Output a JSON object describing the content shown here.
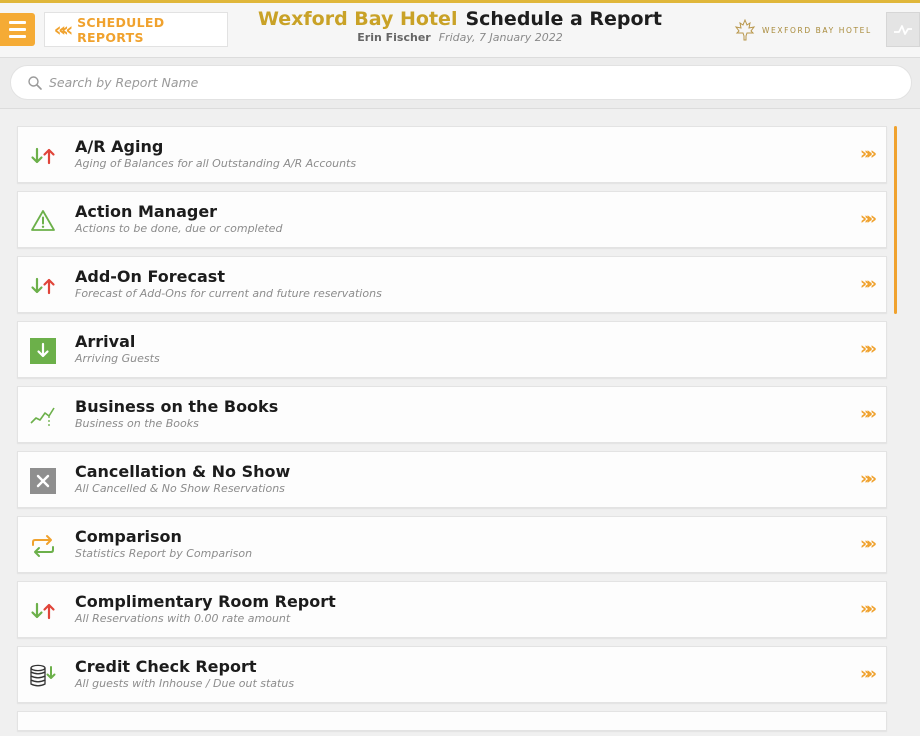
{
  "header": {
    "back_label": "SCHEDULED REPORTS",
    "hotel_name": "Wexford Bay Hotel",
    "page_title": "Schedule a Report",
    "user_name": "Erin Fischer",
    "date": "Friday, 7 January 2022",
    "logo_text": "WEXFORD BAY HOTEL"
  },
  "search": {
    "placeholder": "Search by Report Name",
    "value": ""
  },
  "colors": {
    "accent": "#f0a22e",
    "brand_gold": "#c9a227",
    "green": "#6cb04a",
    "red": "#e0453a",
    "gray": "#8f8f8f"
  },
  "reports": [
    {
      "title": "A/R Aging",
      "subtitle": "Aging of Balances for all Outstanding A/R Accounts",
      "icon": "arrows-up-down-icon"
    },
    {
      "title": "Action Manager",
      "subtitle": "Actions to be done, due or completed",
      "icon": "warning-icon"
    },
    {
      "title": "Add-On Forecast",
      "subtitle": "Forecast of Add-Ons for current and future reservations",
      "icon": "arrows-up-down-icon"
    },
    {
      "title": "Arrival",
      "subtitle": "Arriving Guests",
      "icon": "arrival-icon"
    },
    {
      "title": "Business on the Books",
      "subtitle": "Business on the Books",
      "icon": "trend-chart-icon"
    },
    {
      "title": "Cancellation & No Show",
      "subtitle": "All Cancelled & No Show Reservations",
      "icon": "cancel-icon"
    },
    {
      "title": "Comparison",
      "subtitle": "Statistics Report by Comparison",
      "icon": "compare-arrows-icon"
    },
    {
      "title": "Complimentary Room Report",
      "subtitle": "All Reservations with 0.00 rate amount",
      "icon": "arrows-up-down-icon"
    },
    {
      "title": "Credit Check Report",
      "subtitle": "All guests with Inhouse / Due out status",
      "icon": "coins-icon"
    }
  ]
}
